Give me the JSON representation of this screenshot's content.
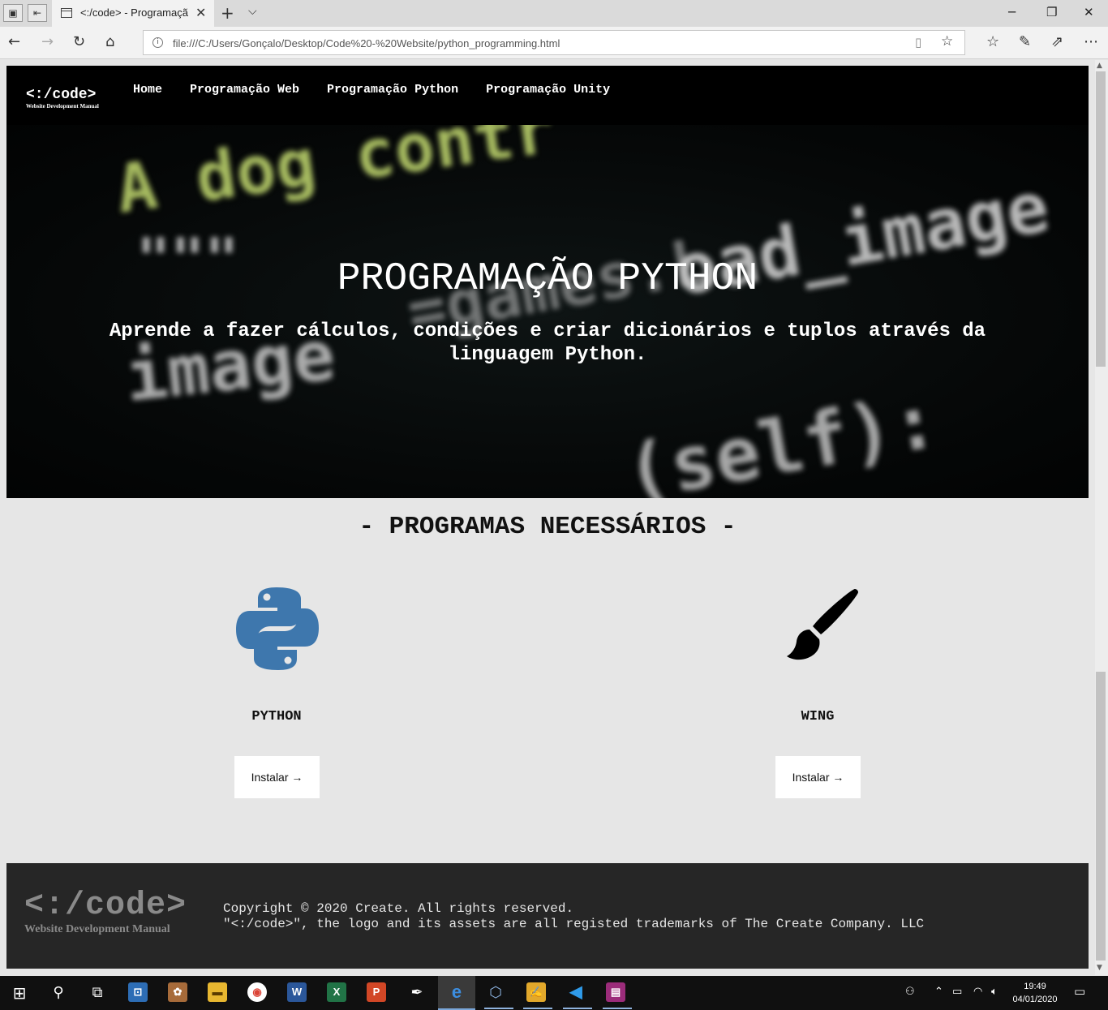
{
  "browser": {
    "tab_title": "<:/code> - Programaçã",
    "address": "file:///C:/Users/Gonçalo/Desktop/Code%20-%20Website/python_programming.html"
  },
  "site": {
    "logo_main": "<:/code>",
    "logo_sub": "Website Development Manual",
    "nav": [
      {
        "label": "Home"
      },
      {
        "label": "Programação Web"
      },
      {
        "label": "Programação Python"
      },
      {
        "label": "Programação Unity"
      }
    ]
  },
  "hero": {
    "title": "PROGRAMAÇÃO PYTHON",
    "subtitle": "Aprende a fazer cálculos, condições e criar dicionários e tuplos através da linguagem Python."
  },
  "section": {
    "title": "- PROGRAMAS NECESSÁRIOS -"
  },
  "programs": [
    {
      "name": "PYTHON",
      "button": "Instalar →",
      "icon": "python-logo-icon",
      "color": "#3e77ad"
    },
    {
      "name": "WING",
      "button": "Instalar →",
      "icon": "paintbrush-icon",
      "color": "#000000"
    }
  ],
  "footer": {
    "logo_main": "<:/code>",
    "logo_sub": "Website Development Manual",
    "line1": "Copyright © 2020 Create. All rights reserved.",
    "line2": "\"<:/code>\", the logo and its assets are all registed trademarks of The Create Company. LLC"
  },
  "taskbar": {
    "time": "19:49",
    "date": "04/01/2020"
  }
}
